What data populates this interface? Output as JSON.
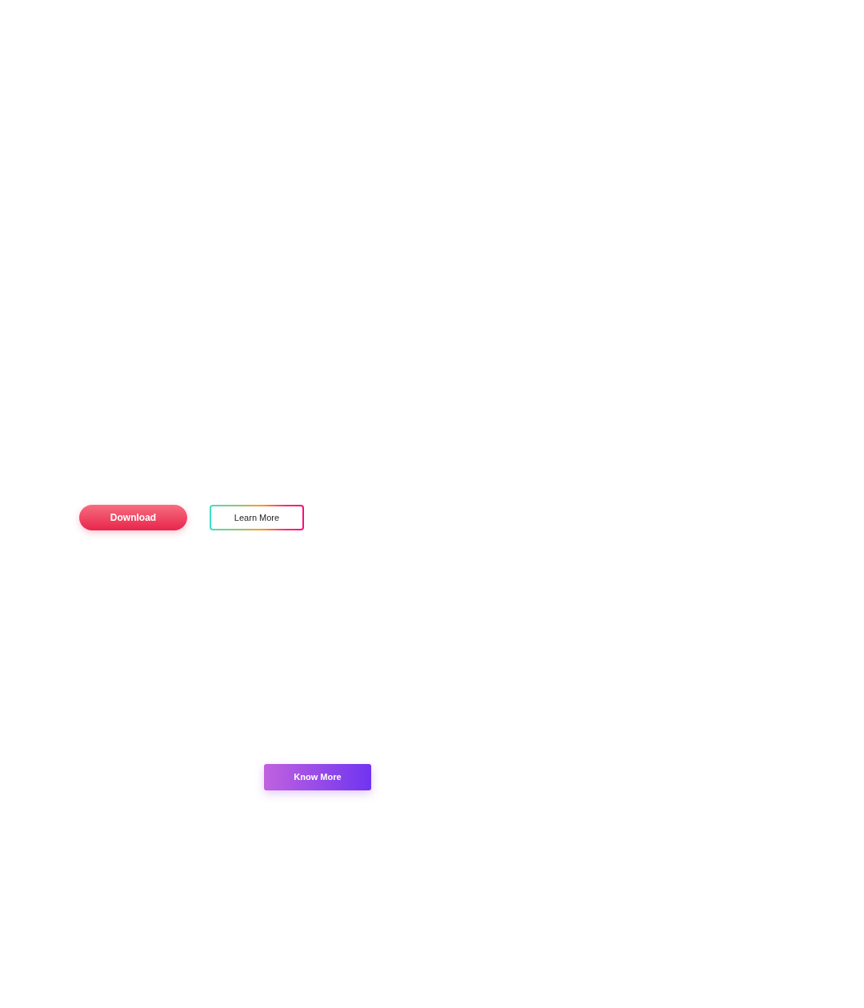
{
  "rows": [
    {
      "buttons": [
        {
          "label": "Download",
          "kind": "pill"
        },
        {
          "label": "Learn More",
          "kind": "outline"
        }
      ]
    },
    {
      "buttons": [
        {
          "label": "Know More",
          "kind": "solid"
        }
      ]
    }
  ]
}
